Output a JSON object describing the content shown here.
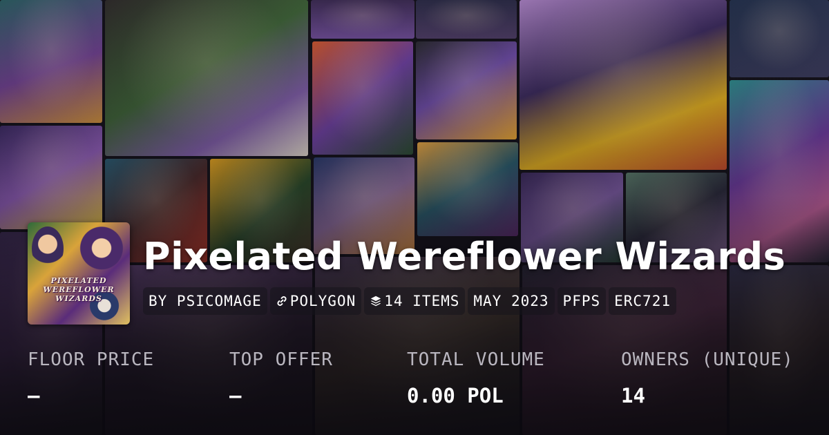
{
  "collection": {
    "title": "Pixelated Wereflower Wizards",
    "logo_text": [
      "PIXELATED",
      "WEREFLOWER",
      "WIZARDS"
    ]
  },
  "tags": [
    {
      "label": "BY PSICOMAGE",
      "icon": null
    },
    {
      "label": "POLYGON",
      "icon": "link-icon"
    },
    {
      "label": "14 ITEMS",
      "icon": "layers-icon"
    },
    {
      "label": "MAY 2023",
      "icon": null
    },
    {
      "label": "PFPS",
      "icon": null
    },
    {
      "label": "ERC721",
      "icon": null
    }
  ],
  "stats": [
    {
      "label": "FLOOR PRICE",
      "value": "—"
    },
    {
      "label": "TOP OFFER",
      "value": "—"
    },
    {
      "label": "TOTAL VOLUME",
      "value": "0.00 POL"
    },
    {
      "label": "OWNERS (UNIQUE)",
      "value": "14"
    }
  ],
  "colors": {
    "background": "#14121a",
    "text": "#ffffff",
    "muted_text": "#b9b6bf"
  }
}
